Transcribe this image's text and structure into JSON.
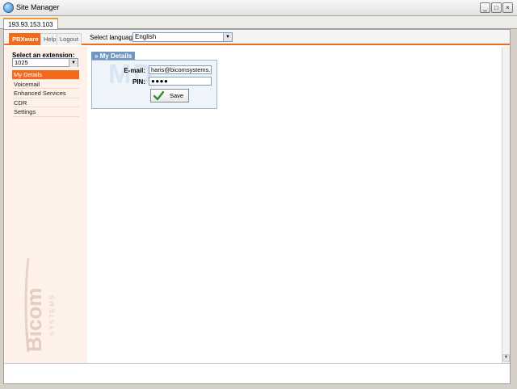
{
  "window": {
    "title": "Site Manager",
    "minimize": "_",
    "maximize": "□",
    "close": "×"
  },
  "tabs": {
    "host": "193.93.153.103"
  },
  "topnav": {
    "tabs": [
      {
        "label": "PBXware"
      },
      {
        "label": "Help"
      },
      {
        "label": "Logout"
      }
    ],
    "language_label": "Select language:",
    "language_value": "English"
  },
  "sidebar": {
    "extension_label": "Select an extension:",
    "extension_value": "1025",
    "items": [
      {
        "label": "My Details"
      },
      {
        "label": "Voicemail"
      },
      {
        "label": "Enhanced Services"
      },
      {
        "label": "CDR"
      },
      {
        "label": "Settings"
      }
    ],
    "logo_text": "Bicom",
    "logo_subtext": "SYSTEMS"
  },
  "panel": {
    "title": "» My Details",
    "watermark": "MD",
    "email_label": "E-mail:",
    "email_value": "haris@bicomsystems.com",
    "pin_label": "PIN:",
    "pin_value": "●●●●",
    "save_label": "Save"
  },
  "colors": {
    "accent": "#f26b1d",
    "panel_header": "#6f97c2",
    "sidebar_bg": "#fdf1ea"
  },
  "icons": [
    "app-icon",
    "check-icon",
    "dropdown-arrow-icon",
    "scroll-down-icon"
  ]
}
